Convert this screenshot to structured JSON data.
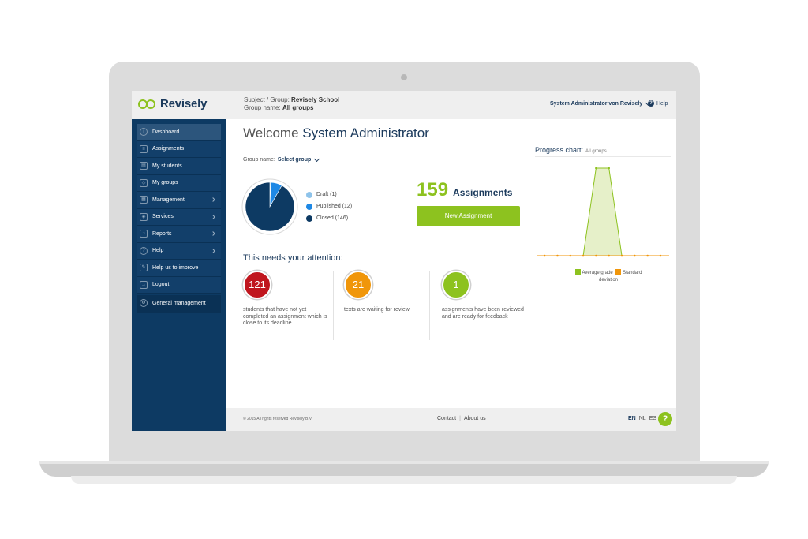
{
  "header": {
    "logo_text": "Revisely",
    "subject_label": "Subject / Group:",
    "subject_value": "Revisely School",
    "group_label": "Group name:",
    "group_value": "All groups",
    "user_menu": "System Administrator von Revisely",
    "help": "Help"
  },
  "sidebar": {
    "items": [
      {
        "label": "Dashboard",
        "icon": "info-icon",
        "active": true
      },
      {
        "label": "Assignments",
        "icon": "assignments-icon"
      },
      {
        "label": "My students",
        "icon": "students-icon"
      },
      {
        "label": "My groups",
        "icon": "groups-icon"
      },
      {
        "label": "Management",
        "icon": "management-icon",
        "arrow": true
      },
      {
        "label": "Services",
        "icon": "services-icon",
        "arrow": true
      },
      {
        "label": "Reports",
        "icon": "reports-icon",
        "arrow": true
      },
      {
        "label": "Help",
        "icon": "help-icon",
        "arrow": true
      },
      {
        "label": "Help us to improve",
        "icon": "feedback-icon"
      },
      {
        "label": "Logout",
        "icon": "logout-icon"
      },
      {
        "label": "General management",
        "icon": "gear-icon"
      }
    ]
  },
  "main": {
    "welcome_prefix": "Welcome",
    "welcome_name": "System Administrator",
    "group_name_label": "Group name:",
    "group_select_value": "Select group",
    "pie_legend": [
      {
        "label": "Draft (1)",
        "color": "#8ec3ea",
        "value": 1
      },
      {
        "label": "Published (12)",
        "color": "#1e88e5",
        "value": 12
      },
      {
        "label": "Closed (146)",
        "color": "#0d3a63",
        "value": 146
      }
    ],
    "assignments_count": "159",
    "assignments_label": "Assignments",
    "new_assignment_button": "New Assignment",
    "attention_title": "This needs your attention:",
    "attention_cards": [
      {
        "count": "121",
        "color": "#c0161e",
        "text": "students that have not yet completed an assignment which is close to its deadline"
      },
      {
        "count": "21",
        "color": "#f0960a",
        "text": "texts are waiting for review"
      },
      {
        "count": "1",
        "color": "#8dc21f",
        "text": "assignments have been reviewed and are ready for feedback"
      }
    ]
  },
  "progress_chart": {
    "title": "Progress chart:",
    "subtitle": "All groups",
    "legend_avg": "Average grade",
    "legend_std": "Standard",
    "legend_std_2": "deviation",
    "avg_color": "#8dc21f",
    "std_color": "#f0960a"
  },
  "chart_data": {
    "type": "area",
    "x": [
      1,
      2,
      3,
      4,
      5,
      6,
      7,
      8,
      9,
      10
    ],
    "series": [
      {
        "name": "Average grade",
        "values": [
          0,
          0,
          0,
          0,
          1,
          1,
          0,
          0,
          0,
          0
        ]
      },
      {
        "name": "Standard deviation",
        "values": [
          0,
          0,
          0,
          0,
          0,
          0,
          0,
          0,
          0,
          0
        ]
      }
    ],
    "ylim": [
      0,
      1
    ]
  },
  "footer": {
    "copyright": "© 2015 All rights reserved Revisely B.V.",
    "contact": "Contact",
    "about": "About us",
    "lang_en": "EN",
    "lang_nl": "NL",
    "lang_es": "ES",
    "help_bubble": "?"
  }
}
